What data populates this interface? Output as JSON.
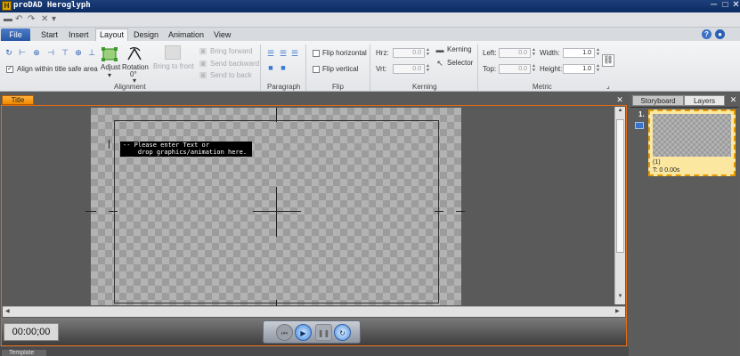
{
  "window": {
    "title": "proDAD Heroglyph",
    "min": "─",
    "max": "□",
    "close": "✕"
  },
  "qat": {
    "save": "▬",
    "undo": "↶",
    "redo": "↷",
    "cut": "✕",
    "dd": "▾"
  },
  "tabs": {
    "file": "File",
    "items": [
      "Start",
      "Insert",
      "Layout",
      "Design",
      "Animation",
      "View"
    ],
    "active": "Layout",
    "help": "?",
    "info": "●"
  },
  "ribbon": {
    "alignment": {
      "label": "Alignment",
      "safe_area_check": "✓",
      "safe_area_label": "Align within title safe area",
      "adjust": "Adjust",
      "adjust_dd": "▾",
      "rotation": "Rotation",
      "rotation_value": "0°",
      "rotation_dd": "▾",
      "bring_to_front": "Bring to front",
      "bring_forward": "Bring forward",
      "send_backward": "Send backward",
      "send_to_back": "Send to back"
    },
    "paragraph": {
      "label": "Paragraph"
    },
    "flip": {
      "label": "Flip",
      "horizontal": "Flip horizontal",
      "vertical": "Flip vertical"
    },
    "kerning": {
      "label": "Kerning",
      "hrz": "Hrz:",
      "vrt": "Vrt:",
      "hrz_value": "0.0",
      "vrt_value": "0.0",
      "kerning_btn": "Kerning",
      "selector_btn": "Selector"
    },
    "metric": {
      "label": "Metric",
      "left": "Left:",
      "top": "Top:",
      "width": "Width:",
      "height": "Height:",
      "left_value": "0.0",
      "top_value": "0.0",
      "width_value": "1.0",
      "height_value": "1.0",
      "expand": "⌟"
    }
  },
  "editor": {
    "tab_label": "Title",
    "close": "✕",
    "hint_line1": "-- Please enter Text or",
    "hint_line2": "    drop graphics/animation here."
  },
  "player": {
    "timecode": "00:00;00"
  },
  "right_panel": {
    "tabs": [
      "Storyboard",
      "Layers"
    ],
    "close": "✕",
    "slide_number": "1.",
    "card_index": "(1)",
    "card_time": "T: 0  0.00s"
  },
  "bottom": {
    "template_tab": "Template"
  }
}
